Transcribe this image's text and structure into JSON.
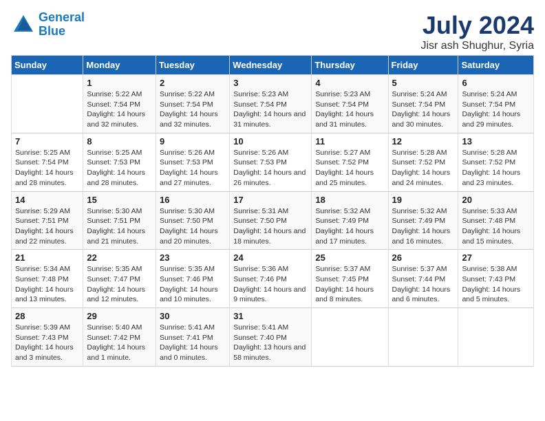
{
  "logo": {
    "line1": "General",
    "line2": "Blue"
  },
  "title": "July 2024",
  "subtitle": "Jisr ash Shughur, Syria",
  "header": {
    "accent_color": "#1a66b5"
  },
  "weekdays": [
    "Sunday",
    "Monday",
    "Tuesday",
    "Wednesday",
    "Thursday",
    "Friday",
    "Saturday"
  ],
  "weeks": [
    [
      {
        "num": "",
        "sunrise": "",
        "sunset": "",
        "daylight": ""
      },
      {
        "num": "1",
        "sunrise": "Sunrise: 5:22 AM",
        "sunset": "Sunset: 7:54 PM",
        "daylight": "Daylight: 14 hours and 32 minutes."
      },
      {
        "num": "2",
        "sunrise": "Sunrise: 5:22 AM",
        "sunset": "Sunset: 7:54 PM",
        "daylight": "Daylight: 14 hours and 32 minutes."
      },
      {
        "num": "3",
        "sunrise": "Sunrise: 5:23 AM",
        "sunset": "Sunset: 7:54 PM",
        "daylight": "Daylight: 14 hours and 31 minutes."
      },
      {
        "num": "4",
        "sunrise": "Sunrise: 5:23 AM",
        "sunset": "Sunset: 7:54 PM",
        "daylight": "Daylight: 14 hours and 31 minutes."
      },
      {
        "num": "5",
        "sunrise": "Sunrise: 5:24 AM",
        "sunset": "Sunset: 7:54 PM",
        "daylight": "Daylight: 14 hours and 30 minutes."
      },
      {
        "num": "6",
        "sunrise": "Sunrise: 5:24 AM",
        "sunset": "Sunset: 7:54 PM",
        "daylight": "Daylight: 14 hours and 29 minutes."
      }
    ],
    [
      {
        "num": "7",
        "sunrise": "Sunrise: 5:25 AM",
        "sunset": "Sunset: 7:54 PM",
        "daylight": "Daylight: 14 hours and 28 minutes."
      },
      {
        "num": "8",
        "sunrise": "Sunrise: 5:25 AM",
        "sunset": "Sunset: 7:53 PM",
        "daylight": "Daylight: 14 hours and 28 minutes."
      },
      {
        "num": "9",
        "sunrise": "Sunrise: 5:26 AM",
        "sunset": "Sunset: 7:53 PM",
        "daylight": "Daylight: 14 hours and 27 minutes."
      },
      {
        "num": "10",
        "sunrise": "Sunrise: 5:26 AM",
        "sunset": "Sunset: 7:53 PM",
        "daylight": "Daylight: 14 hours and 26 minutes."
      },
      {
        "num": "11",
        "sunrise": "Sunrise: 5:27 AM",
        "sunset": "Sunset: 7:52 PM",
        "daylight": "Daylight: 14 hours and 25 minutes."
      },
      {
        "num": "12",
        "sunrise": "Sunrise: 5:28 AM",
        "sunset": "Sunset: 7:52 PM",
        "daylight": "Daylight: 14 hours and 24 minutes."
      },
      {
        "num": "13",
        "sunrise": "Sunrise: 5:28 AM",
        "sunset": "Sunset: 7:52 PM",
        "daylight": "Daylight: 14 hours and 23 minutes."
      }
    ],
    [
      {
        "num": "14",
        "sunrise": "Sunrise: 5:29 AM",
        "sunset": "Sunset: 7:51 PM",
        "daylight": "Daylight: 14 hours and 22 minutes."
      },
      {
        "num": "15",
        "sunrise": "Sunrise: 5:30 AM",
        "sunset": "Sunset: 7:51 PM",
        "daylight": "Daylight: 14 hours and 21 minutes."
      },
      {
        "num": "16",
        "sunrise": "Sunrise: 5:30 AM",
        "sunset": "Sunset: 7:50 PM",
        "daylight": "Daylight: 14 hours and 20 minutes."
      },
      {
        "num": "17",
        "sunrise": "Sunrise: 5:31 AM",
        "sunset": "Sunset: 7:50 PM",
        "daylight": "Daylight: 14 hours and 18 minutes."
      },
      {
        "num": "18",
        "sunrise": "Sunrise: 5:32 AM",
        "sunset": "Sunset: 7:49 PM",
        "daylight": "Daylight: 14 hours and 17 minutes."
      },
      {
        "num": "19",
        "sunrise": "Sunrise: 5:32 AM",
        "sunset": "Sunset: 7:49 PM",
        "daylight": "Daylight: 14 hours and 16 minutes."
      },
      {
        "num": "20",
        "sunrise": "Sunrise: 5:33 AM",
        "sunset": "Sunset: 7:48 PM",
        "daylight": "Daylight: 14 hours and 15 minutes."
      }
    ],
    [
      {
        "num": "21",
        "sunrise": "Sunrise: 5:34 AM",
        "sunset": "Sunset: 7:48 PM",
        "daylight": "Daylight: 14 hours and 13 minutes."
      },
      {
        "num": "22",
        "sunrise": "Sunrise: 5:35 AM",
        "sunset": "Sunset: 7:47 PM",
        "daylight": "Daylight: 14 hours and 12 minutes."
      },
      {
        "num": "23",
        "sunrise": "Sunrise: 5:35 AM",
        "sunset": "Sunset: 7:46 PM",
        "daylight": "Daylight: 14 hours and 10 minutes."
      },
      {
        "num": "24",
        "sunrise": "Sunrise: 5:36 AM",
        "sunset": "Sunset: 7:46 PM",
        "daylight": "Daylight: 14 hours and 9 minutes."
      },
      {
        "num": "25",
        "sunrise": "Sunrise: 5:37 AM",
        "sunset": "Sunset: 7:45 PM",
        "daylight": "Daylight: 14 hours and 8 minutes."
      },
      {
        "num": "26",
        "sunrise": "Sunrise: 5:37 AM",
        "sunset": "Sunset: 7:44 PM",
        "daylight": "Daylight: 14 hours and 6 minutes."
      },
      {
        "num": "27",
        "sunrise": "Sunrise: 5:38 AM",
        "sunset": "Sunset: 7:43 PM",
        "daylight": "Daylight: 14 hours and 5 minutes."
      }
    ],
    [
      {
        "num": "28",
        "sunrise": "Sunrise: 5:39 AM",
        "sunset": "Sunset: 7:43 PM",
        "daylight": "Daylight: 14 hours and 3 minutes."
      },
      {
        "num": "29",
        "sunrise": "Sunrise: 5:40 AM",
        "sunset": "Sunset: 7:42 PM",
        "daylight": "Daylight: 14 hours and 1 minute."
      },
      {
        "num": "30",
        "sunrise": "Sunrise: 5:41 AM",
        "sunset": "Sunset: 7:41 PM",
        "daylight": "Daylight: 14 hours and 0 minutes."
      },
      {
        "num": "31",
        "sunrise": "Sunrise: 5:41 AM",
        "sunset": "Sunset: 7:40 PM",
        "daylight": "Daylight: 13 hours and 58 minutes."
      },
      {
        "num": "",
        "sunrise": "",
        "sunset": "",
        "daylight": ""
      },
      {
        "num": "",
        "sunrise": "",
        "sunset": "",
        "daylight": ""
      },
      {
        "num": "",
        "sunrise": "",
        "sunset": "",
        "daylight": ""
      }
    ]
  ]
}
